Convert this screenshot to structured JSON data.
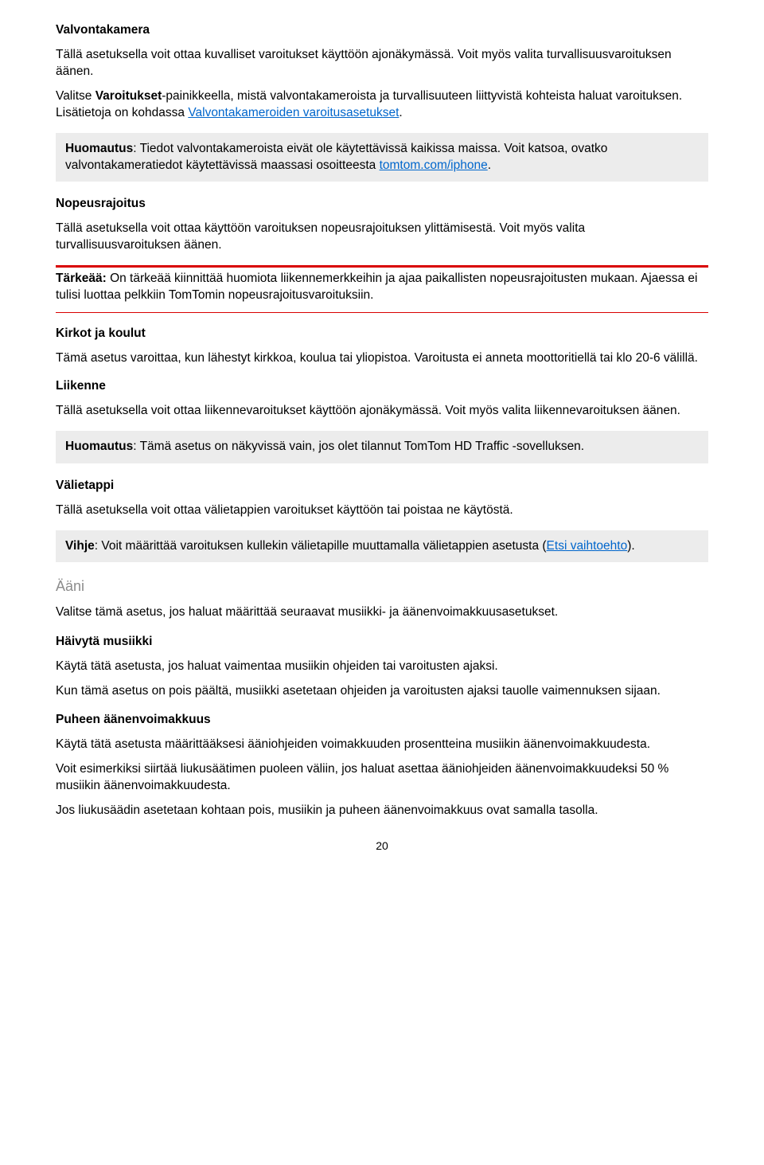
{
  "sec_valvontakamera": {
    "heading": "Valvontakamera",
    "p1": "Tällä asetuksella voit ottaa kuvalliset varoitukset käyttöön ajonäkymässä. Voit myös valita turvallisuusvaroituksen äänen.",
    "p2_before": "Valitse ",
    "p2_boldword": "Varoitukset",
    "p2_mid": "-painikkeella, mistä valvontakameroista ja turvallisuuteen liittyvistä kohteista haluat varoituksen. Lisätietoja on kohdassa ",
    "p2_link": "Valvontakameroiden varoitusasetukset",
    "p2_after": "."
  },
  "note1": {
    "lead": "Huomautus",
    "body1": ": Tiedot valvontakameroista eivät ole käytettävissä kaikissa maissa. Voit katsoa, ovatko valvontakameratiedot käytettävissä maassasi osoitteesta ",
    "link": "tomtom.com/iphone",
    "body2": "."
  },
  "sec_nopeusrajoitus": {
    "heading": "Nopeusrajoitus",
    "p1": "Tällä asetuksella voit ottaa käyttöön varoituksen nopeusrajoituksen ylittämisestä. Voit myös valita turvallisuusvaroituksen äänen."
  },
  "tarkeaa": {
    "lead": "Tärkeää:",
    "body": " On tärkeää kiinnittää huomiota liikennemerkkeihin ja ajaa paikallisten nopeusrajoitusten mukaan. Ajaessa ei tulisi luottaa pelkkiin TomTomin nopeusrajoitusvaroituksiin."
  },
  "sec_kirkot": {
    "heading": "Kirkot ja koulut",
    "p1": "Tämä asetus varoittaa, kun lähestyt kirkkoa, koulua tai yliopistoa. Varoitusta ei anneta moottoritiellä tai klo 20-6 välillä."
  },
  "sec_liikenne": {
    "heading": "Liikenne",
    "p1": "Tällä asetuksella voit ottaa liikennevaroitukset käyttöön ajonäkymässä. Voit myös valita liikennevaroituksen äänen."
  },
  "note2": {
    "lead": "Huomautus",
    "body": ": Tämä asetus on näkyvissä vain, jos olet tilannut TomTom HD Traffic -sovelluksen."
  },
  "sec_valietappi": {
    "heading": "Välietappi",
    "p1": "Tällä asetuksella voit ottaa välietappien varoitukset käyttöön tai poistaa ne käytöstä."
  },
  "note3": {
    "lead": "Vihje",
    "body1": ": Voit määrittää varoituksen kullekin välietapille muuttamalla välietappien asetusta (",
    "link": "Etsi vaihtoehto",
    "body2": ")."
  },
  "sec_aani": {
    "heading": "Ääni",
    "p1": "Valitse tämä asetus, jos haluat määrittää seuraavat musiikki- ja äänenvoimakkuusasetukset."
  },
  "sec_haivyta": {
    "heading": "Häivytä musiikki",
    "p1": "Käytä tätä asetusta, jos haluat vaimentaa musiikin ohjeiden tai varoitusten ajaksi.",
    "p2": "Kun tämä asetus on pois päältä, musiikki asetetaan ohjeiden ja varoitusten ajaksi tauolle vaimennuksen sijaan."
  },
  "sec_puhe": {
    "heading": "Puheen äänenvoimakkuus",
    "p1": "Käytä tätä asetusta määrittääksesi ääniohjeiden voimakkuuden prosentteina musiikin äänenvoimakkuudesta.",
    "p2": "Voit esimerkiksi siirtää liukusäätimen puoleen väliin, jos haluat asettaa ääniohjeiden äänenvoimakkuudeksi 50 % musiikin äänenvoimakkuudesta.",
    "p3": "Jos liukusäädin asetetaan kohtaan pois, musiikin ja puheen äänenvoimakkuus ovat samalla tasolla."
  },
  "page_number": "20"
}
